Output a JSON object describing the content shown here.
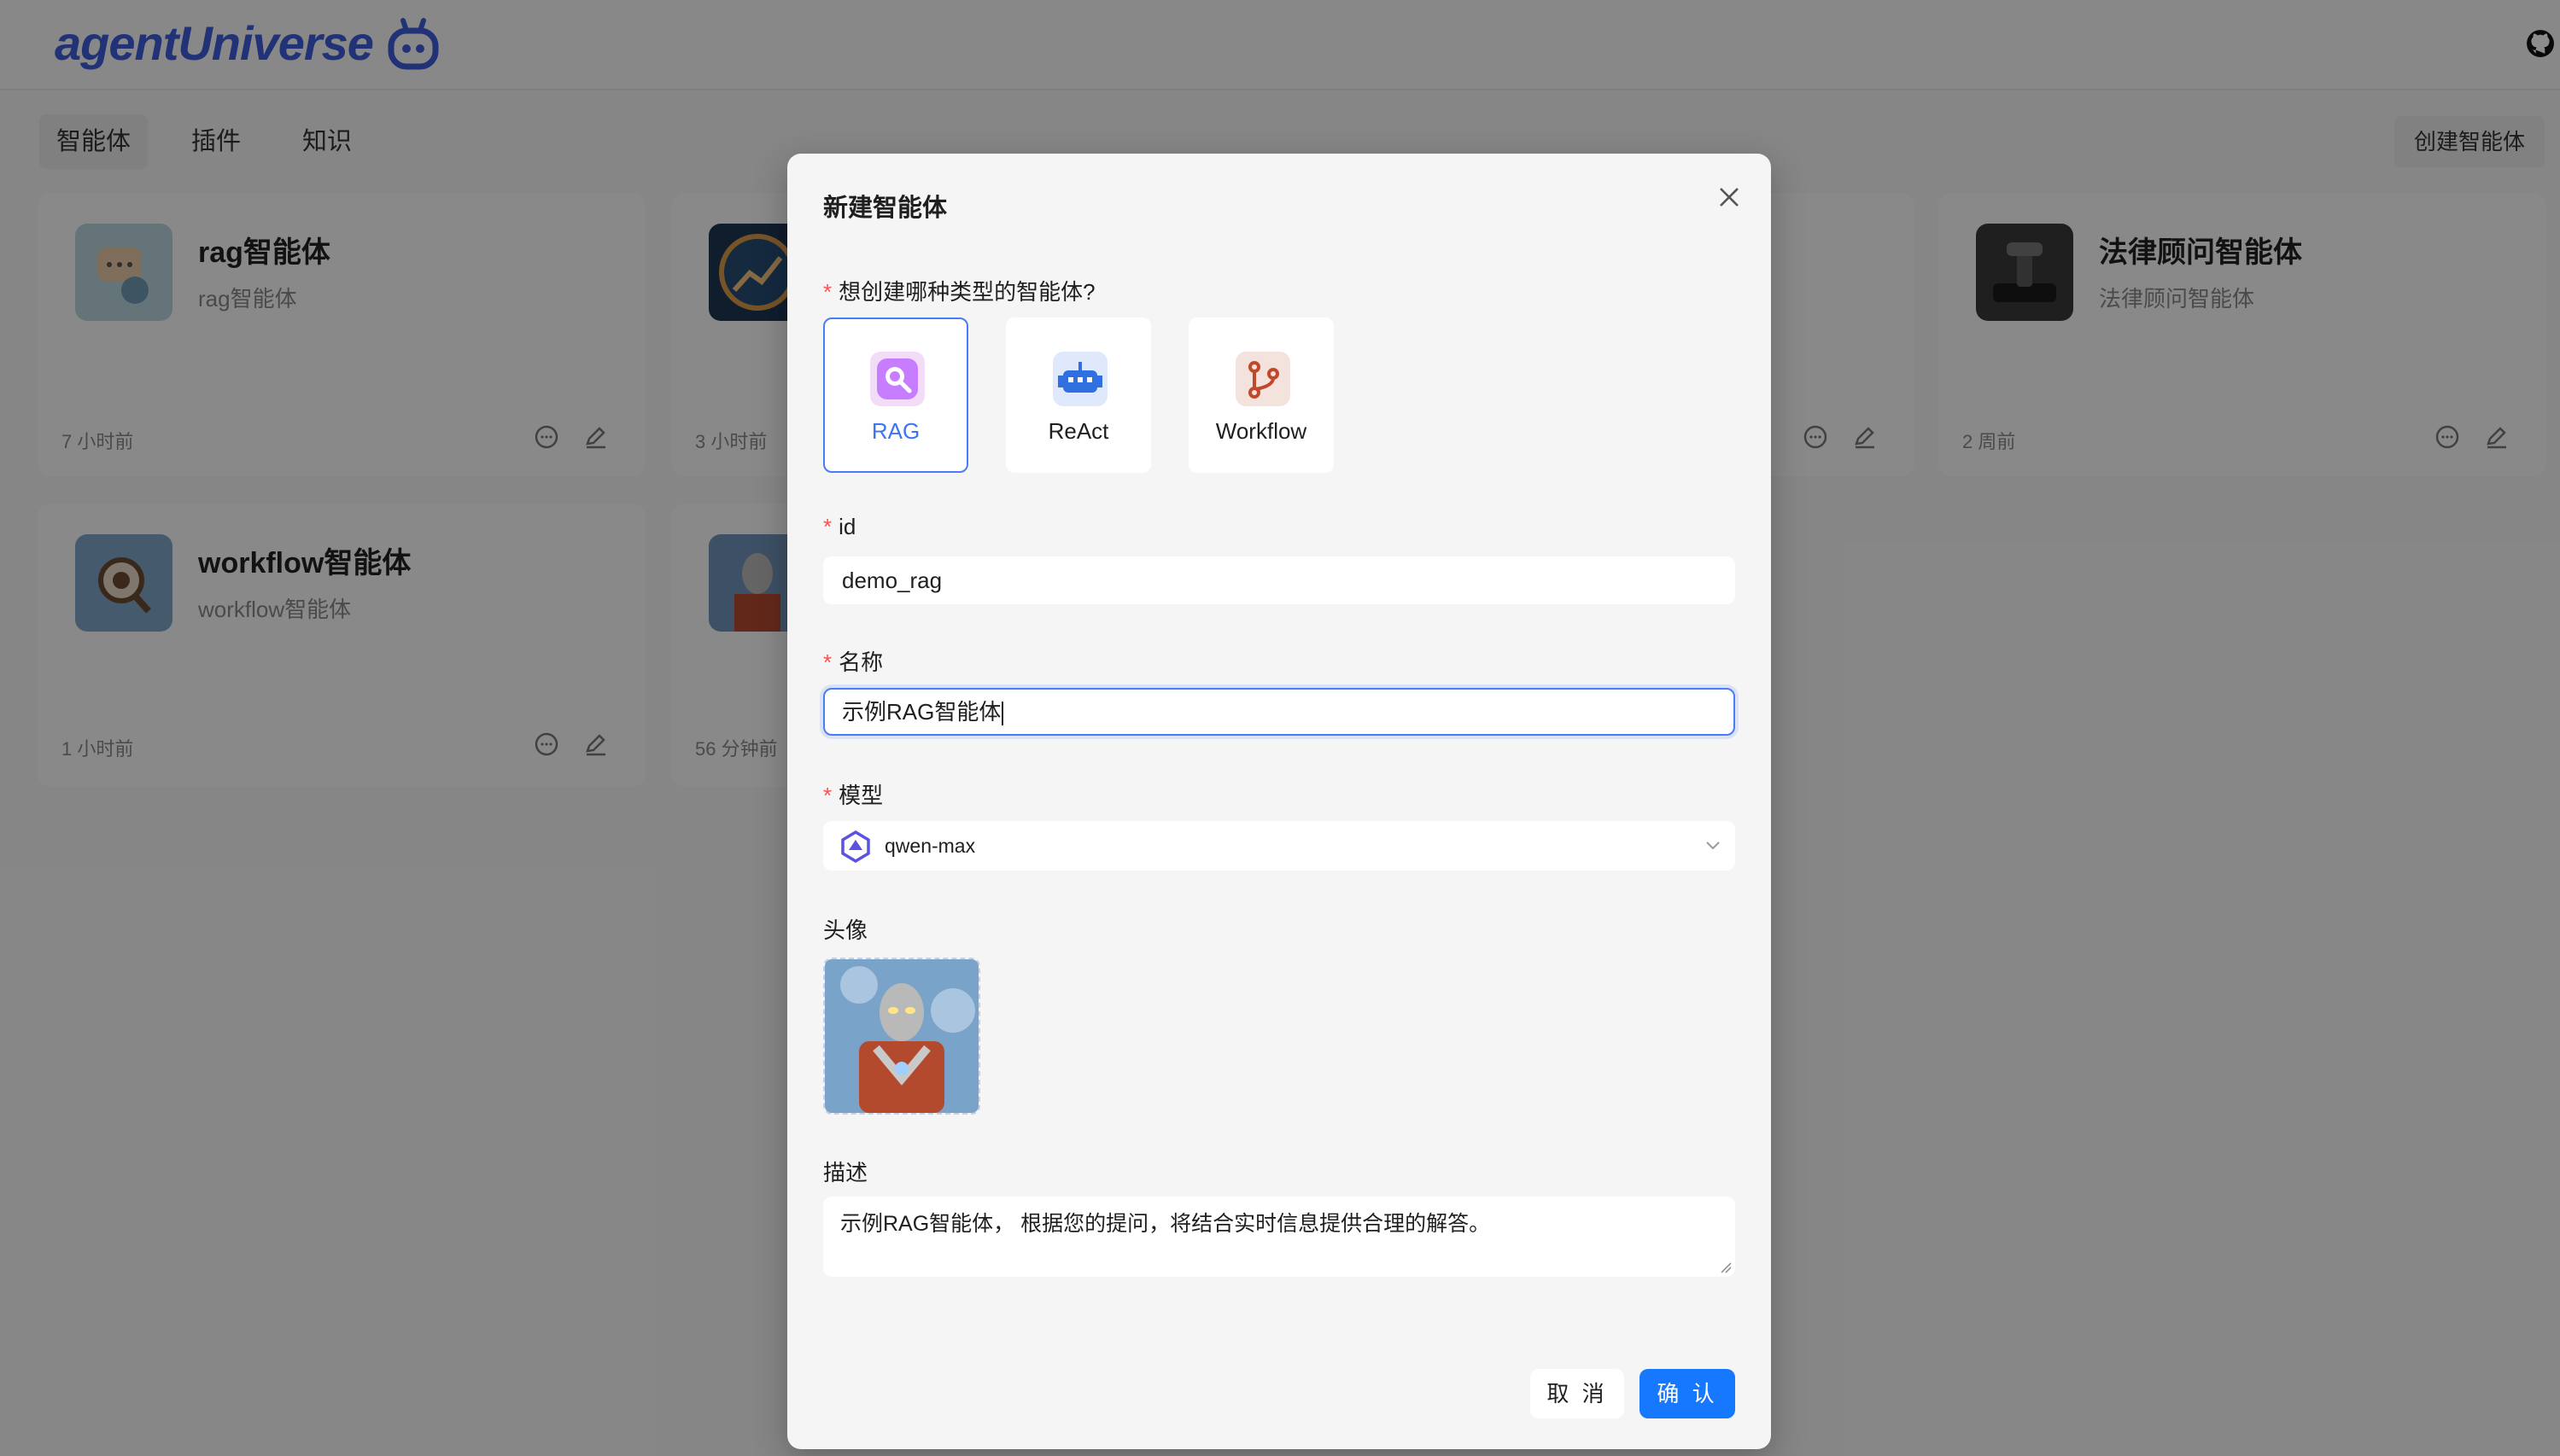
{
  "app": {
    "brand": "agentUniverse"
  },
  "nav": {
    "tabs": [
      {
        "label": "智能体",
        "active": true
      },
      {
        "label": "插件",
        "active": false
      },
      {
        "label": "知识",
        "active": false
      }
    ],
    "create_label": "创建智能体"
  },
  "cards": [
    {
      "title": "rag智能体",
      "desc": "rag智能体",
      "time": "7 小时前"
    },
    {
      "title": "",
      "desc": "",
      "time": "3 小时前"
    },
    {
      "title": "",
      "desc": "",
      "time": ""
    },
    {
      "title": "法律顾问智能体",
      "desc": "法律顾问智能体",
      "time": "2 周前"
    },
    {
      "title": "workflow智能体",
      "desc": "workflow智能体",
      "time": "1 小时前"
    },
    {
      "title": "",
      "desc": "",
      "time": "56 分钟前"
    }
  ],
  "modal": {
    "title": "新建智能体",
    "type_question": "想创建哪种类型的智能体?",
    "types": [
      {
        "label": "RAG",
        "icon": "search-icon",
        "selected": true,
        "color": "#c77dff"
      },
      {
        "label": "ReAct",
        "icon": "robot-icon",
        "selected": false,
        "color": "#2f6fe0"
      },
      {
        "label": "Workflow",
        "icon": "branch-icon",
        "selected": false,
        "color": "#c0492b"
      }
    ],
    "id_label": "id",
    "id_value": "demo_rag",
    "name_label": "名称",
    "name_value": "示例RAG智能体",
    "model_label": "模型",
    "model_value": "qwen-max",
    "avatar_label": "头像",
    "desc_label": "描述",
    "desc_value": "示例RAG智能体， 根据您的提问，将结合实时信息提供合理的解答。",
    "cancel_label": "取 消",
    "ok_label": "确 认"
  },
  "colors": {
    "primary": "#1677ff",
    "required": "#ff4d4f",
    "brand": "#3d5bd9"
  }
}
